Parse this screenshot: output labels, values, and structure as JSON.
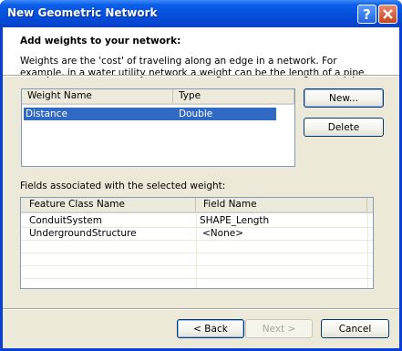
{
  "window": {
    "title": "New Geometric Network"
  },
  "banner": {
    "title": "Add weights to your network:",
    "description": "Weights are the 'cost' of traveling along an edge in a network. For example, in a water utility network a weight can be the length of a pipe."
  },
  "weights": {
    "columns": [
      "Weight Name",
      "Type"
    ],
    "rows": [
      {
        "name": "Distance",
        "type": "Double",
        "selected": true
      }
    ]
  },
  "side_buttons": {
    "new": "New...",
    "delete": "Delete"
  },
  "fields": {
    "label": "Fields associated with the selected weight:",
    "columns": [
      "Feature Class Name",
      "Field Name"
    ],
    "rows": [
      {
        "feature_class": "ConduitSystem",
        "field": "SHAPE_Length"
      },
      {
        "feature_class": "UndergroundStructure",
        "field": "<None>"
      }
    ]
  },
  "footer": {
    "back": "< Back",
    "next": "Next >",
    "cancel": "Cancel"
  },
  "colors": {
    "title_bar": "#0651dc",
    "selection": "#316ac5",
    "dialog_bg": "#ece9d8"
  },
  "icons": {
    "help": "help-icon",
    "close": "close-icon"
  }
}
